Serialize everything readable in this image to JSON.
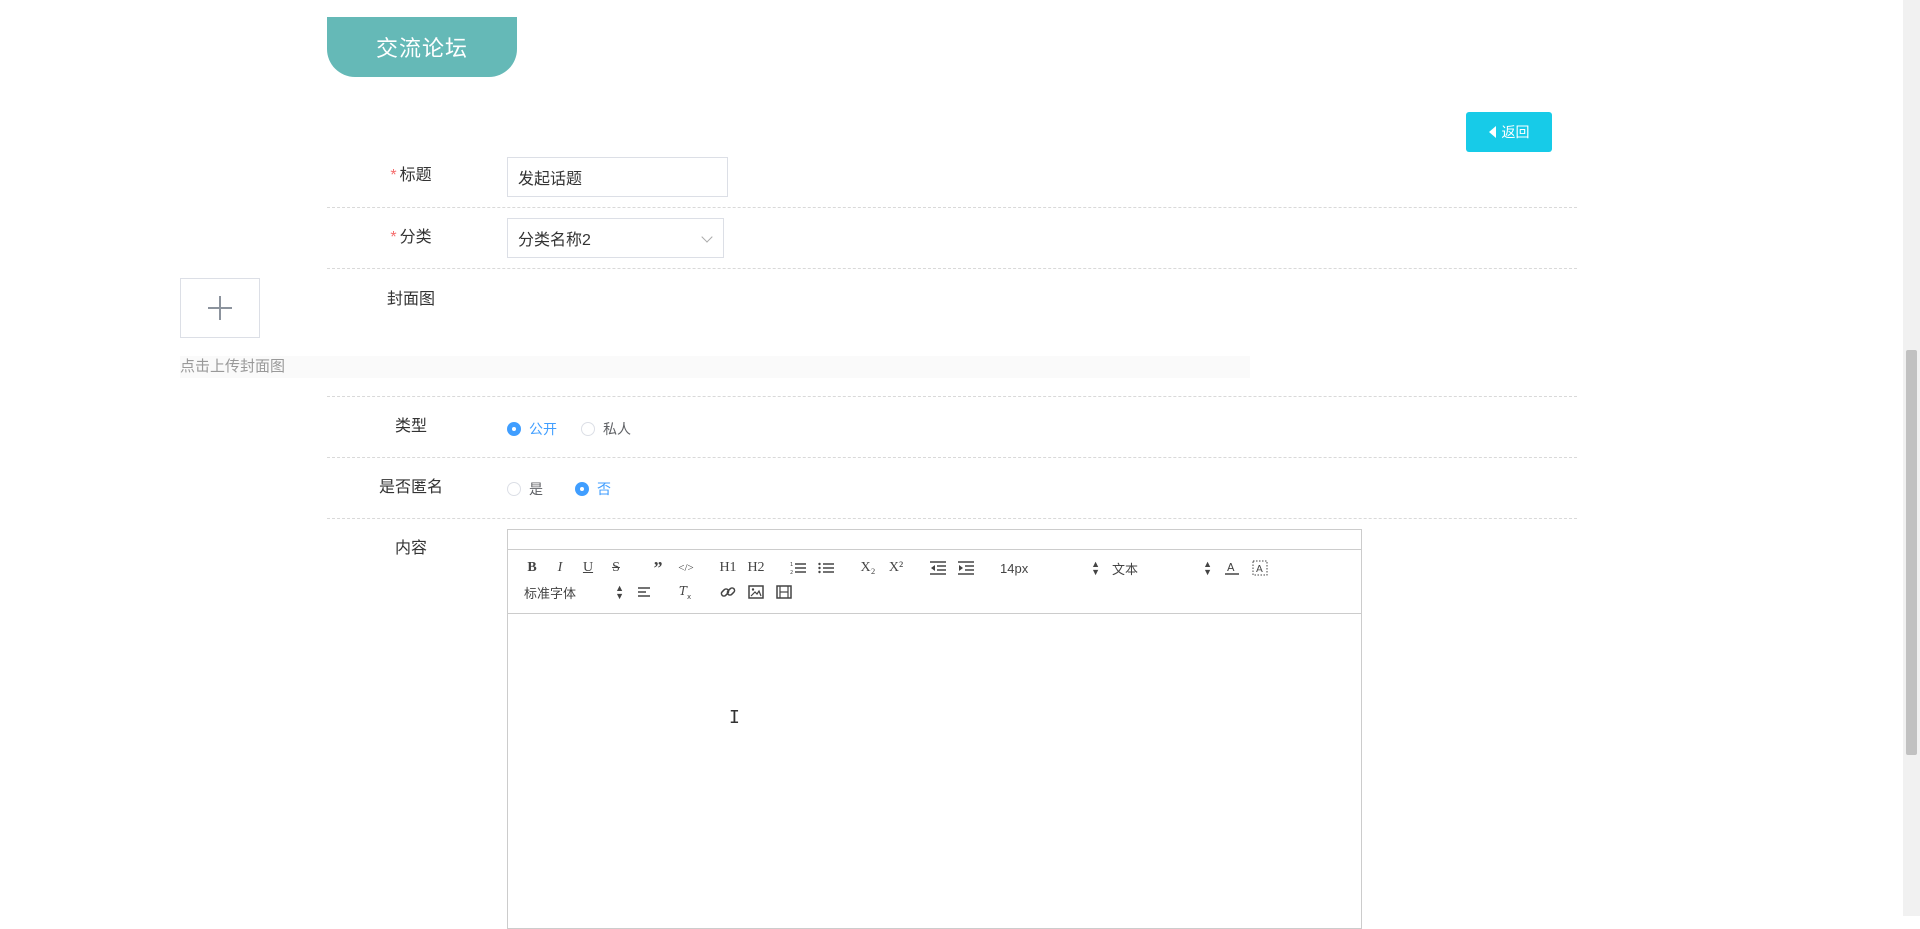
{
  "header": {
    "title": "交流论坛",
    "back_label": "返回"
  },
  "form": {
    "title": {
      "label": "标题",
      "required_mark": "*",
      "value": "发起话题"
    },
    "category": {
      "label": "分类",
      "required_mark": "*",
      "value": "分类名称2"
    },
    "cover": {
      "label": "封面图",
      "tip": "点击上传封面图"
    },
    "type": {
      "label": "类型",
      "options": [
        "公开",
        "私人"
      ],
      "selected": "公开"
    },
    "anonymous": {
      "label": "是否匿名",
      "options": [
        "是",
        "否"
      ],
      "selected": "否"
    },
    "content": {
      "label": "内容"
    }
  },
  "editor": {
    "toolbar_row1": [
      "B",
      "I",
      "U",
      "S",
      "”",
      "</>",
      "H1",
      "H2",
      "ordered-list",
      "bullet-list",
      "X₂",
      "X²",
      "outdent",
      "indent"
    ],
    "font_size": "14px",
    "header_select": "文本",
    "font_family": "标准字体",
    "toolbar_row2": [
      "align",
      "clean",
      "link",
      "image",
      "video"
    ],
    "colors": {
      "text": "#444444",
      "accent": "#409eff"
    }
  },
  "colors": {
    "banner": "#65b9b7",
    "back_button": "#17cbe8",
    "required": "#f56c6c",
    "radio_checked": "#409eff"
  }
}
